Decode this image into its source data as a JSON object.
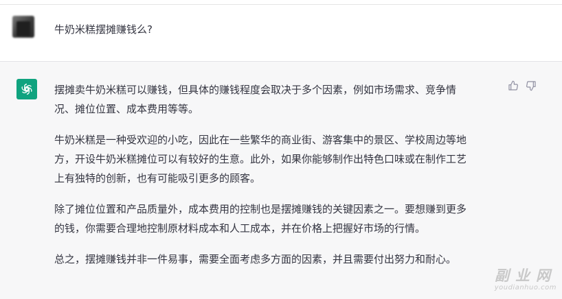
{
  "conversation": {
    "user_message": "牛奶米糕摆摊赚钱么?",
    "assistant_paragraphs": [
      [
        "摆摊卖牛奶米糕可以赚钱，但具体的赚钱程度会取决于多个因素，例如市场需求、竞争情",
        "况、摊位位置、成本费用等等。"
      ],
      [
        "牛奶米糕是一种受欢迎的小吃，因此在一些繁华的商业街、游客集中的景区、学校周边等地",
        "方，开设牛奶米糕摊位可以有较好的生意。此外，如果你能够制作出特色口味或在制作工艺",
        "上有独特的创新，也有可能吸引更多的顾客。"
      ],
      [
        "除了摊位位置和产品质量外，成本费用的控制也是摆摊赚钱的关键因素之一。要想赚到更多",
        "的钱，你需要合理地控制原材料成本和人工成本，并在价格上把握好市场的行情。"
      ],
      [
        "总之，摆摊赚钱并非一件易事，需要全面考虑多方面的因素，并且需要付出努力和耐心。"
      ]
    ]
  },
  "icons": {
    "user_avatar": "blurred-user-avatar",
    "assistant_avatar": "openai-logo-icon",
    "thumbs_up": "thumbs-up-icon",
    "thumbs_down": "thumbs-down-icon"
  },
  "watermark": {
    "title": "副业网",
    "domain": "youdianhuo.com"
  },
  "colors": {
    "assistant_bg": "#f7f7f8",
    "brand_green": "#10a37f",
    "text": "#343541"
  }
}
